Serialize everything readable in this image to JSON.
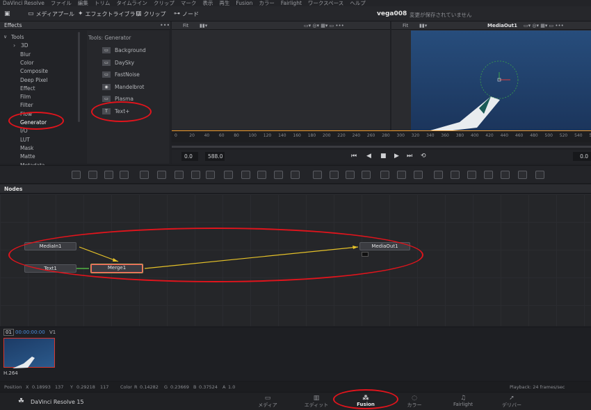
{
  "menu": [
    "DaVinci Resolve",
    "ファイル",
    "編集",
    "トリム",
    "タイムライン",
    "クリップ",
    "マーク",
    "表示",
    "再生",
    "Fusion",
    "カラー",
    "Fairlight",
    "ワークスペース",
    "ヘルプ"
  ],
  "toolbar": {
    "media_pool": "メディアプール",
    "effects_library": "エフェクトライブラリ",
    "clips": "クリップ",
    "nodes": "ノード",
    "project_name": "vega008",
    "save_status": "変更が保存されていません"
  },
  "effects": {
    "title": "Effects",
    "tree": [
      "Tools",
      "3D",
      "Blur",
      "Color",
      "Composite",
      "Deep Pixel",
      "Effect",
      "Film",
      "Filter",
      "Flow",
      "Generator",
      "I/O",
      "LUT",
      "Mask",
      "Matte",
      "Metadata"
    ],
    "list_title": "Tools: Generator",
    "items": [
      "Background",
      "DaySky",
      "FastNoise",
      "Mandelbrot",
      "Plasma",
      "Text+"
    ]
  },
  "viewer": {
    "fit_left": "Fit",
    "fit_right": "Fit",
    "right_title": "MediaOut1",
    "ticks": [
      "0",
      "20",
      "40",
      "60",
      "80",
      "100",
      "120",
      "140",
      "160",
      "180",
      "200",
      "220",
      "240",
      "260",
      "280",
      "300",
      "320",
      "340",
      "360",
      "380",
      "400",
      "420",
      "440",
      "460",
      "480",
      "500",
      "520",
      "540",
      "560"
    ],
    "start_time": "0.0",
    "end_time": "588.0",
    "current_time": "0.0"
  },
  "nodes": {
    "title": "Nodes",
    "media_in": "MediaIn1",
    "text": "Text1",
    "merge": "Merge1",
    "media_out": "MediaOut1"
  },
  "clips": {
    "index": "01",
    "timecode": "00:00:00:00",
    "track": "V1",
    "codec": "H.264"
  },
  "status": {
    "position_label": "Position",
    "x_label": "X",
    "x_value": "0.18993",
    "x_px": "137",
    "y_label": "Y",
    "y_value": "0.29218",
    "y_px": "117",
    "color_label": "Color",
    "r_label": "R",
    "r_value": "0.14282",
    "g_label": "G",
    "g_value": "0.23669",
    "b_label": "B",
    "b_value": "0.37524",
    "a_label": "A",
    "a_value": "1.0",
    "playback": "Playback: 24 frames/sec"
  },
  "bottom": {
    "app_name": "DaVinci Resolve 15",
    "pages": [
      "メディア",
      "エディット",
      "Fusion",
      "カラー",
      "Fairlight",
      "デリバー"
    ]
  },
  "colors": {
    "accent_orange": "#f09a2a",
    "annotation_red": "#e2141c",
    "connection_yellow": "#e6c229"
  }
}
